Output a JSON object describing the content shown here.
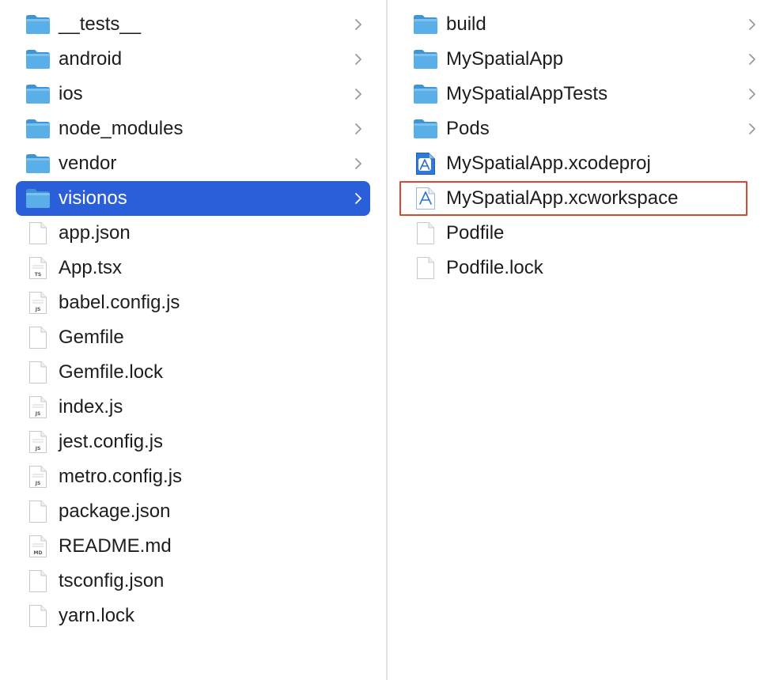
{
  "colors": {
    "selection": "#2b5fd9",
    "highlight_outline": "#d9482f",
    "folder": "#5aafe8",
    "divider": "#e3e3e3"
  },
  "left_column": {
    "items": [
      {
        "label": "__tests__",
        "icon": "folder",
        "has_children": true
      },
      {
        "label": "android",
        "icon": "folder",
        "has_children": true
      },
      {
        "label": "ios",
        "icon": "folder",
        "has_children": true
      },
      {
        "label": "node_modules",
        "icon": "folder",
        "has_children": true
      },
      {
        "label": "vendor",
        "icon": "folder",
        "has_children": true
      },
      {
        "label": "visionos",
        "icon": "folder",
        "has_children": true,
        "selected": true
      },
      {
        "label": "app.json",
        "icon": "file"
      },
      {
        "label": "App.tsx",
        "icon": "file-ts",
        "badge": "TS"
      },
      {
        "label": "babel.config.js",
        "icon": "file-js",
        "badge": "JS"
      },
      {
        "label": "Gemfile",
        "icon": "file"
      },
      {
        "label": "Gemfile.lock",
        "icon": "file"
      },
      {
        "label": "index.js",
        "icon": "file-js",
        "badge": "JS"
      },
      {
        "label": "jest.config.js",
        "icon": "file-js",
        "badge": "JS"
      },
      {
        "label": "metro.config.js",
        "icon": "file-js",
        "badge": "JS"
      },
      {
        "label": "package.json",
        "icon": "file"
      },
      {
        "label": "README.md",
        "icon": "file-md",
        "badge": "MD"
      },
      {
        "label": "tsconfig.json",
        "icon": "file"
      },
      {
        "label": "yarn.lock",
        "icon": "file"
      }
    ]
  },
  "right_column": {
    "items": [
      {
        "label": "build",
        "icon": "folder",
        "has_children": true
      },
      {
        "label": "MySpatialApp",
        "icon": "folder",
        "has_children": true
      },
      {
        "label": "MySpatialAppTests",
        "icon": "folder",
        "has_children": true
      },
      {
        "label": "Pods",
        "icon": "folder",
        "has_children": true
      },
      {
        "label": "MySpatialApp.xcodeproj",
        "icon": "xcodeproj"
      },
      {
        "label": "MySpatialApp.xcworkspace",
        "icon": "xcworkspace",
        "highlighted": true
      },
      {
        "label": "Podfile",
        "icon": "file"
      },
      {
        "label": "Podfile.lock",
        "icon": "file"
      }
    ]
  }
}
